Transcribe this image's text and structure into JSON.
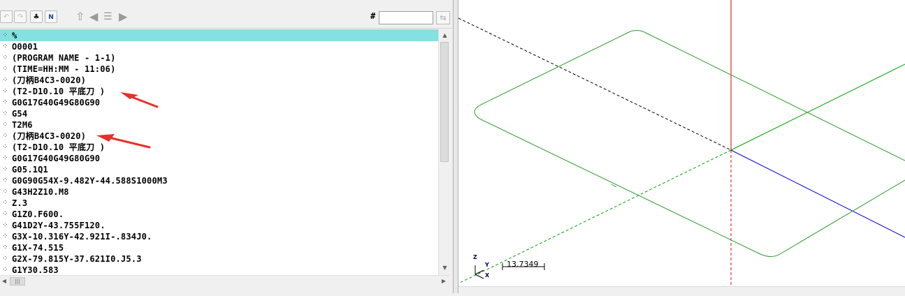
{
  "toolbar": {
    "buttons": [
      {
        "name": "undo",
        "glyph": "↶"
      },
      {
        "name": "redo",
        "glyph": "↷"
      },
      {
        "name": "find",
        "glyph": "♣"
      },
      {
        "name": "renumber",
        "glyph": "N"
      }
    ],
    "line_label": "#",
    "line_input_value": ""
  },
  "editor": {
    "lines": [
      "%",
      "O0001",
      "(PROGRAM NAME - 1-1)",
      "(TIME=HH:MM - 11:06)",
      "(刀柄B4C3-0020)",
      "(T2-D10.10 平底刀 )",
      "G0G17G40G49G80G90",
      "G54",
      "T2M6",
      "(刀柄B4C3-0020)",
      "(T2-D10.10 平底刀 )",
      "G0G17G40G49G80G90",
      "G05.1Q1",
      "G0G90G54X-9.482Y-44.588S1000M3",
      "G43H2Z10.M8",
      "Z.3",
      "G1Z0.F600.",
      "G41D2Y-43.755F120.",
      "G3X-10.316Y-42.921I-.834J0.",
      "G1X-74.515",
      "G2X-79.815Y-37.621I0.J5.3",
      "G1Y30.583"
    ],
    "selected_line": 0,
    "line_marker": "⁘",
    "annotation_color": "#e8302a"
  },
  "viewport": {
    "axis_triad": {
      "z": "Z",
      "y": "Y",
      "x": "X"
    },
    "scale_value": "13.7349",
    "colors": {
      "z_axis": "#e00000",
      "x_axis": "#0000d0",
      "y_axis": "#00a000",
      "toolpath": "#2e9a2e"
    }
  }
}
